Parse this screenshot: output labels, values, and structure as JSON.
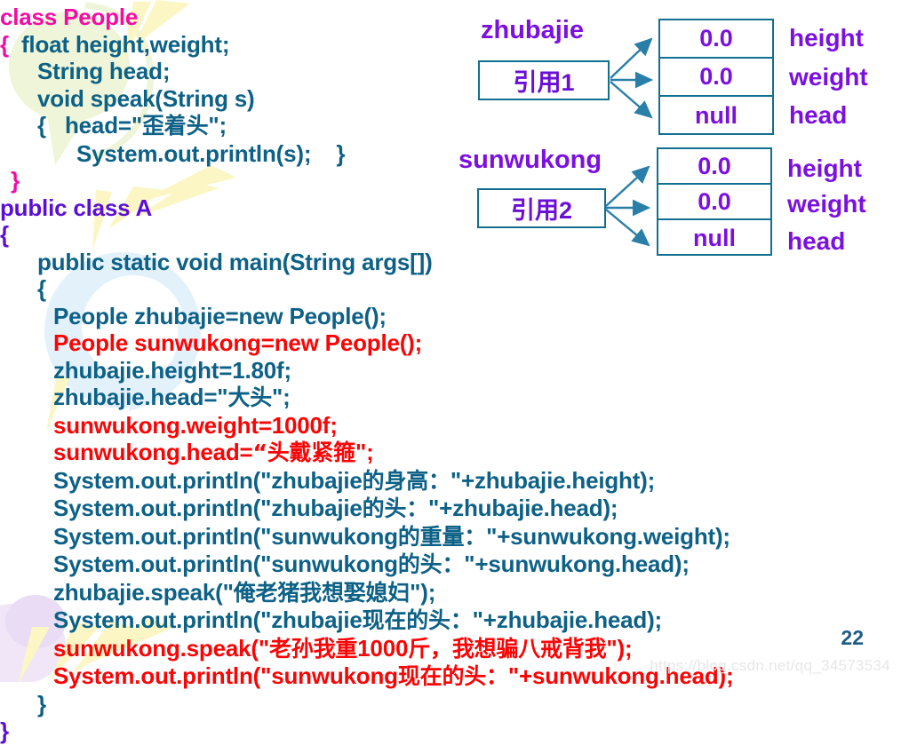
{
  "slide": {
    "page_number": "22",
    "watermark": "https://blog.csdn.net/qq_34573534"
  },
  "colors": {
    "teal": "#0d6186",
    "red": "#fa0505",
    "magenta": "#f50ca5",
    "violet": "#5b0fd6",
    "purple_text": "#7b10e0",
    "box_border": "#11708f",
    "arrow": "#2a7fa8",
    "page_number": "#1c5c86",
    "watermark": "#e7e7e7"
  },
  "code": {
    "lines": [
      {
        "id": "l01",
        "indent": 0,
        "color": "magenta",
        "text": "class People"
      },
      {
        "id": "l02",
        "indent": 0,
        "color": "magenta",
        "text": "{",
        "tail_color": "teal",
        "tail": "  float height,weight;"
      },
      {
        "id": "l03",
        "indent": 42,
        "color": "teal",
        "text": "String head;"
      },
      {
        "id": "l04",
        "indent": 42,
        "color": "teal",
        "text": "void speak(String s)"
      },
      {
        "id": "l05",
        "indent": 42,
        "color": "teal",
        "text": "{   head=\"歪着头\";"
      },
      {
        "id": "l06",
        "indent": 86,
        "color": "teal",
        "text": "System.out.println(s);    }"
      },
      {
        "id": "l07",
        "indent": 12,
        "color": "magenta",
        "text": "}"
      },
      {
        "id": "l08",
        "indent": 0,
        "color": "violet",
        "text": "public class A"
      },
      {
        "id": "l09",
        "indent": 0,
        "color": "violet",
        "text": "{"
      },
      {
        "id": "l10",
        "indent": 42,
        "color": "teal",
        "text": "public static void main(String args[])"
      },
      {
        "id": "l11",
        "indent": 42,
        "color": "teal",
        "text": "{"
      },
      {
        "id": "l12",
        "indent": 60,
        "color": "teal",
        "text": "People zhubajie=new People();"
      },
      {
        "id": "l13",
        "indent": 60,
        "color": "red",
        "text": "People sunwukong=new People();"
      },
      {
        "id": "l14",
        "indent": 60,
        "color": "teal",
        "text": "zhubajie.height=1.80f;"
      },
      {
        "id": "l15",
        "indent": 60,
        "color": "teal",
        "text": "zhubajie.head=\"大头\";"
      },
      {
        "id": "l16",
        "indent": 60,
        "color": "red",
        "text": "sunwukong.weight=1000f;"
      },
      {
        "id": "l17",
        "indent": 60,
        "color": "red",
        "text": "sunwukong.head=“头戴紧箍\";"
      },
      {
        "id": "l18",
        "indent": 60,
        "color": "teal",
        "text": "System.out.println(\"zhubajie的身高：\"+zhubajie.height);"
      },
      {
        "id": "l19",
        "indent": 60,
        "color": "teal",
        "text": "System.out.println(\"zhubajie的头：\"+zhubajie.head);"
      },
      {
        "id": "l20",
        "indent": 60,
        "color": "teal",
        "text": "System.out.println(\"sunwukong的重量：\"+sunwukong.weight);"
      },
      {
        "id": "l21",
        "indent": 60,
        "color": "teal",
        "text": "System.out.println(\"sunwukong的头：\"+sunwukong.head);"
      },
      {
        "id": "l22",
        "indent": 60,
        "color": "teal",
        "text": "zhubajie.speak(\"俺老猪我想娶媳妇\");"
      },
      {
        "id": "l23",
        "indent": 60,
        "color": "teal",
        "text": "System.out.println(\"zhubajie现在的头：\"+zhubajie.head);"
      },
      {
        "id": "l24",
        "indent": 60,
        "color": "red",
        "text": "sunwukong.speak(\"老孙我重1000斤，我想骗八戒背我\");"
      },
      {
        "id": "l25",
        "indent": 60,
        "color": "red",
        "text": "System.out.println(\"sunwukong现在的头：\"+sunwukong.head);"
      },
      {
        "id": "l26",
        "indent": 42,
        "color": "teal",
        "text": "}"
      },
      {
        "id": "l27",
        "indent": 0,
        "color": "violet",
        "text": "}"
      }
    ]
  },
  "diagram": {
    "objects": [
      {
        "id": "obj1",
        "ref_title": "zhubajie",
        "ref_box_label": "引用1",
        "cells": [
          "0.0",
          "0.0",
          "null"
        ],
        "field_labels": [
          "height",
          "weight",
          "head"
        ]
      },
      {
        "id": "obj2",
        "ref_title": "sunwukong",
        "ref_box_label": "引用2",
        "cells": [
          "0.0",
          "0.0",
          "null"
        ],
        "field_labels": [
          "height",
          "weight",
          "head"
        ]
      }
    ]
  }
}
